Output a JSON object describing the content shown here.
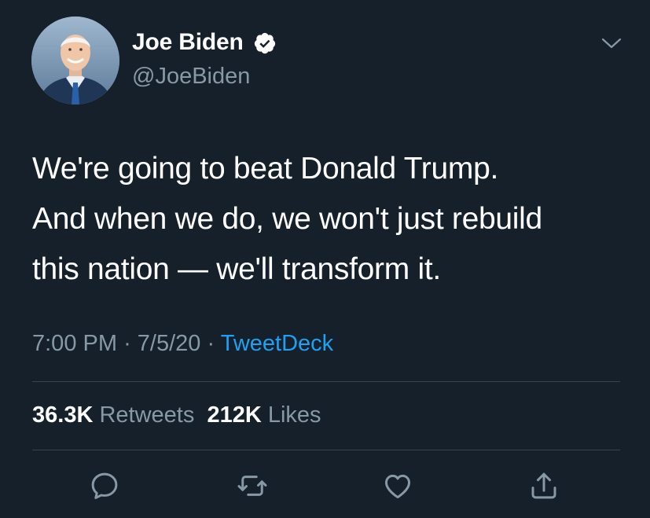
{
  "author": {
    "display_name": "Joe Biden",
    "handle": "@JoeBiden",
    "verified": true,
    "avatar_icon": "avatar-photo"
  },
  "tweet": {
    "text": "We're going to beat Donald Trump.\nAnd when we do, we won't just rebuild\nthis nation — we'll transform it.",
    "time": "7:00 PM",
    "separator": "·",
    "date": "7/5/20",
    "source": "TweetDeck"
  },
  "stats": {
    "retweets_count": "36.3K",
    "retweets_label": "Retweets",
    "likes_count": "212K",
    "likes_label": "Likes"
  },
  "actions": [
    "reply-icon",
    "retweet-icon",
    "like-icon",
    "share-icon"
  ],
  "colors": {
    "background": "#15202b",
    "text_primary": "#ffffff",
    "text_secondary": "#8899a6",
    "accent": "#1da1f2",
    "divider": "#38444d"
  }
}
